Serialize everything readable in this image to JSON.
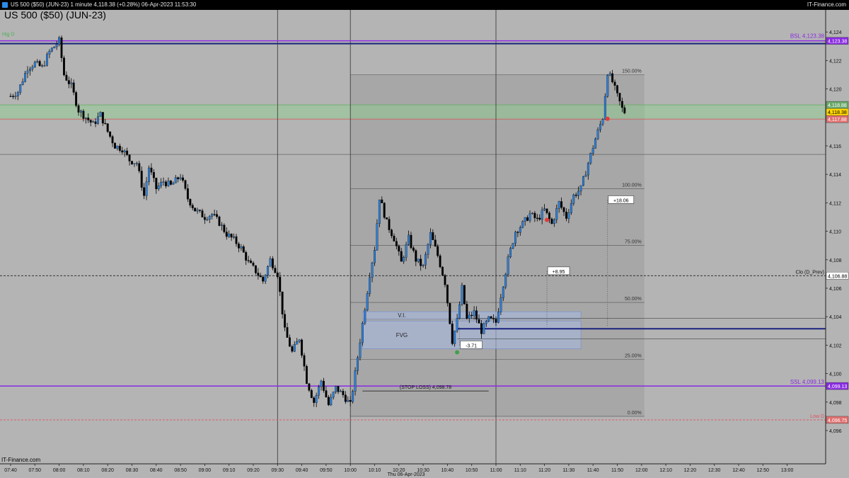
{
  "window": {
    "title": "US 500 ($50) (JUN-23) 1 minute 4,118.38 (+0.28%) 06-Apr-2023 11:53:30",
    "brand": "IT-Finance.com",
    "watermark": "IT-Finance.com"
  },
  "chart_data": {
    "type": "candlestick",
    "title": "US 500 ($50) (JUN-23)",
    "date_label": "Thu 06-Apr-2023",
    "ylim": [
      4095,
      4125
    ],
    "y_ticks": [
      "4,124",
      "4,122",
      "4,120",
      "4,118",
      "4,116",
      "4,114",
      "4,112",
      "4,110",
      "4,108",
      "4,106",
      "4,104",
      "4,102",
      "4,100",
      "4,098",
      "4,096"
    ],
    "x_ticks": [
      "07:40",
      "07:50",
      "08:00",
      "08:10",
      "08:20",
      "08:30",
      "08:40",
      "08:50",
      "09:00",
      "09:10",
      "09:20",
      "09:30",
      "09:40",
      "09:50",
      "10:00",
      "10:10",
      "10:20",
      "10:30",
      "10:40",
      "10:50",
      "11:00",
      "11:10",
      "11:20",
      "11:30",
      "11:40",
      "11:50",
      "12:00",
      "12:10",
      "12:20",
      "12:30",
      "12:40",
      "12:50",
      "13:00"
    ],
    "vertical_lines": [
      "09:30",
      "10:00",
      "11:00"
    ],
    "price_path": [
      [
        "07:40",
        4119.5
      ],
      [
        "07:43",
        4119.8
      ],
      [
        "07:47",
        4121.5
      ],
      [
        "07:50",
        4121.8
      ],
      [
        "07:53",
        4121.5
      ],
      [
        "07:56",
        4122.6
      ],
      [
        "08:00",
        4123.38
      ],
      [
        "08:02",
        4121.0
      ],
      [
        "08:05",
        4120.2
      ],
      [
        "08:08",
        4118.5
      ],
      [
        "08:11",
        4118.0
      ],
      [
        "08:14",
        4117.5
      ],
      [
        "08:17",
        4118.2
      ],
      [
        "08:20",
        4117.0
      ],
      [
        "08:23",
        4116.0
      ],
      [
        "08:26",
        4115.8
      ],
      [
        "08:29",
        4115.0
      ],
      [
        "08:32",
        4114.8
      ],
      [
        "08:35",
        4112.5
      ],
      [
        "08:37",
        4114.5
      ],
      [
        "08:40",
        4113.0
      ],
      [
        "08:43",
        4113.5
      ],
      [
        "08:46",
        4113.2
      ],
      [
        "08:50",
        4113.9
      ],
      [
        "08:53",
        4112.3
      ],
      [
        "08:56",
        4111.5
      ],
      [
        "09:00",
        4111.0
      ],
      [
        "09:03",
        4111.2
      ],
      [
        "09:06",
        4110.6
      ],
      [
        "09:09",
        4109.8
      ],
      [
        "09:12",
        4109.4
      ],
      [
        "09:15",
        4108.8
      ],
      [
        "09:18",
        4107.8
      ],
      [
        "09:21",
        4107.2
      ],
      [
        "09:24",
        4106.5
      ],
      [
        "09:27",
        4108.0
      ],
      [
        "09:30",
        4107.0
      ],
      [
        "09:33",
        4103.0
      ],
      [
        "09:36",
        4101.5
      ],
      [
        "09:39",
        4102.5
      ],
      [
        "09:42",
        4099.5
      ],
      [
        "09:45",
        4098.0
      ],
      [
        "09:48",
        4099.5
      ],
      [
        "09:51",
        4097.8
      ],
      [
        "09:54",
        4099.0
      ],
      [
        "09:57",
        4098.5
      ],
      [
        "10:00",
        4097.8
      ],
      [
        "10:02",
        4100.0
      ],
      [
        "10:05",
        4103.5
      ],
      [
        "10:08",
        4107.0
      ],
      [
        "10:10",
        4108.8
      ],
      [
        "10:12",
        4112.4
      ],
      [
        "10:15",
        4110.6
      ],
      [
        "10:18",
        4109.5
      ],
      [
        "10:21",
        4107.8
      ],
      [
        "10:24",
        4109.5
      ],
      [
        "10:27",
        4108.0
      ],
      [
        "10:30",
        4107.5
      ],
      [
        "10:33",
        4109.8
      ],
      [
        "10:36",
        4108.3
      ],
      [
        "10:39",
        4106.4
      ],
      [
        "10:42",
        4102.3
      ],
      [
        "10:44",
        4103.7
      ],
      [
        "10:46",
        4106.0
      ],
      [
        "10:48",
        4103.8
      ],
      [
        "10:51",
        4104.3
      ],
      [
        "10:54",
        4103.0
      ],
      [
        "10:57",
        4103.8
      ],
      [
        "11:00",
        4103.6
      ],
      [
        "11:02",
        4105.5
      ],
      [
        "11:05",
        4108.0
      ],
      [
        "11:08",
        4110.0
      ],
      [
        "11:11",
        4110.5
      ],
      [
        "11:14",
        4111.2
      ],
      [
        "11:17",
        4110.8
      ],
      [
        "11:20",
        4111.5
      ],
      [
        "11:23",
        4110.5
      ],
      [
        "11:26",
        4112.0
      ],
      [
        "11:29",
        4111.0
      ],
      [
        "11:32",
        4112.5
      ],
      [
        "11:35",
        4113.0
      ],
      [
        "11:38",
        4114.8
      ],
      [
        "11:41",
        4116.5
      ],
      [
        "11:44",
        4118.0
      ],
      [
        "11:46",
        4121.2
      ],
      [
        "11:48",
        4120.5
      ],
      [
        "11:50",
        4119.5
      ],
      [
        "11:52",
        4118.6
      ],
      [
        "11:53",
        4118.38
      ]
    ],
    "levels": {
      "bsl": {
        "label": "BSL 4,123.38",
        "value": 4123.38,
        "color": "#8a2be2"
      },
      "ssl": {
        "label": "SSL 4,099.13",
        "value": 4099.13,
        "color": "#8a2be2"
      },
      "clo_d_prev": {
        "label": "Clo (D_Prev)",
        "value": 4106.88
      },
      "low_d": {
        "label": "Low D",
        "value": 4096.75,
        "color": "#e05060"
      },
      "hig_d": {
        "label": "Hig D",
        "value": 4123.38,
        "color": "#4caf50"
      },
      "blue_level": {
        "value": 4103.15,
        "color": "#1a237e"
      },
      "current_price": 4118.38,
      "zone_top": 4118.88,
      "zone_bottom": 4117.88,
      "line_4115": 4115.4
    },
    "fib": {
      "x_from": "10:00",
      "x_to": "11:53",
      "y_low": 4097.0,
      "y_high": 4121.0,
      "levels": [
        {
          "label": "150.00%",
          "value": 4121.0
        },
        {
          "label": "100.00%",
          "value": 4113.0
        },
        {
          "label": "75.00%",
          "value": 4109.0
        },
        {
          "label": "50.00%",
          "value": 4105.0
        },
        {
          "label": "25.00%",
          "value": 4101.0
        },
        {
          "label": "0.00%",
          "value": 4097.0
        }
      ]
    },
    "zones": [
      {
        "label": "V.I.",
        "x_from": "10:05",
        "x_to": "11:35",
        "y_from": 4103.85,
        "y_to": 4104.35
      },
      {
        "label": "FVG",
        "x_from": "10:05",
        "x_to": "11:35",
        "y_from": 4101.75,
        "y_to": 4103.7
      }
    ],
    "stop_loss": {
      "label": "(STOP LOSS) 4,098.78",
      "value": 4098.78,
      "x_from": "10:05",
      "x_to": "10:57"
    },
    "trade_labels": [
      {
        "label": "-3.71",
        "time": "10:45",
        "value": 4102.0
      },
      {
        "label": "+8.95",
        "time": "11:21",
        "value": 4107.2
      },
      {
        "label": "+18.06",
        "time": "11:46",
        "value": 4112.2
      }
    ],
    "price_boxes": [
      {
        "label": "4,123.38",
        "value": 4123.38,
        "bg": "#8a2be2",
        "fg": "#ffffff"
      },
      {
        "label": "4,118.88",
        "value": 4118.88,
        "bg": "#6aa86a",
        "fg": "#ffffff"
      },
      {
        "label": "4,118.38",
        "value": 4118.38,
        "bg": "#ffd700",
        "fg": "#000000"
      },
      {
        "label": "4,117.88",
        "value": 4117.88,
        "bg": "#e07070",
        "fg": "#ffffff"
      },
      {
        "label": "4,106.88",
        "value": 4106.88,
        "bg": "#ffffff",
        "fg": "#000000"
      },
      {
        "label": "4,099.13",
        "value": 4099.13,
        "bg": "#8a2be2",
        "fg": "#ffffff"
      },
      {
        "label": "4,096.75",
        "value": 4096.75,
        "bg": "#e07070",
        "fg": "#ffffff"
      }
    ],
    "colors": {
      "up": "#2f7fd6",
      "down": "#000000",
      "background": "#b4b4b4"
    }
  }
}
